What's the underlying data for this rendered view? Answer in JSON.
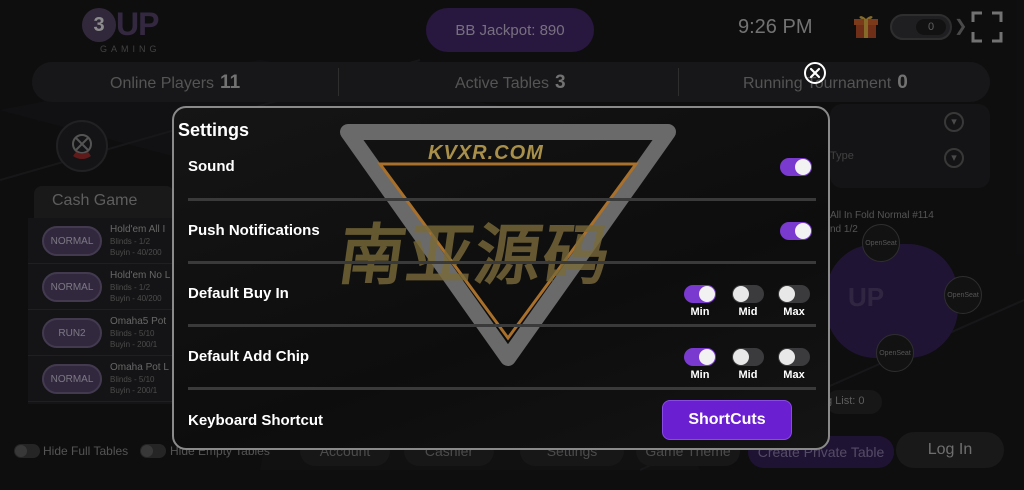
{
  "header": {
    "logo_number": "3",
    "logo_text": "UP",
    "logo_subtext": "GAMING",
    "jackpot": "BB Jackpot: 890",
    "time": "9:26 PM",
    "coins": "0"
  },
  "stats": {
    "online_label": "Online Players",
    "online_value": "11",
    "active_label": "Active Tables",
    "active_value": "3",
    "tournament_label": "Running Tournament",
    "tournament_value": "0"
  },
  "lobby": {
    "cash_tab": "Cash Game",
    "games": [
      {
        "chip": "NORMAL",
        "name": "Hold'em All I",
        "blinds": "Blinds - 1/2",
        "buyin": "Buyin - 40/200"
      },
      {
        "chip": "NORMAL",
        "name": "Hold'em No L",
        "blinds": "Blinds - 1/2",
        "buyin": "Buyin - 40/200"
      },
      {
        "chip": "RUN2",
        "name": "Omaha5 Pot",
        "blinds": "Blinds - 5/10",
        "buyin": "Buyin - 200/1"
      },
      {
        "chip": "NORMAL",
        "name": "Omaha Pot L",
        "blinds": "Blinds - 5/10",
        "buyin": "Buyin - 200/1"
      }
    ],
    "right_panel_type": "Type",
    "table_name": "All In Fold Normal #114",
    "table_blinds": "nd 1/2",
    "seat_label": "OpenSeat",
    "table_logo": "UP",
    "waiting": "g List: 0"
  },
  "bottom": {
    "hide_full": "Hide Full Tables",
    "hide_empty": "Hide Empty Tables",
    "account": "Account",
    "cashier": "Cashier",
    "settings": "Settings",
    "game_theme": "Game Theme",
    "create_private": "Create Private Table",
    "login": "Log In"
  },
  "settings_modal": {
    "title": "Settings",
    "sound_label": "Sound",
    "sound_on": true,
    "push_label": "Push Notifications",
    "push_on": true,
    "buyin_label": "Default Buy In",
    "buyin_selected": "Min",
    "addchip_label": "Default Add Chip",
    "addchip_selected": "Min",
    "option_min": "Min",
    "option_mid": "Mid",
    "option_max": "Max",
    "shortcut_label": "Keyboard Shortcut",
    "shortcut_button": "ShortCuts",
    "watermark_site": "KVXR.COM",
    "watermark_text": "南亚源码"
  },
  "colors": {
    "accent": "#7a3ad0",
    "button": "#6a1fd0",
    "jackpot_bg": "#4a2a74"
  }
}
